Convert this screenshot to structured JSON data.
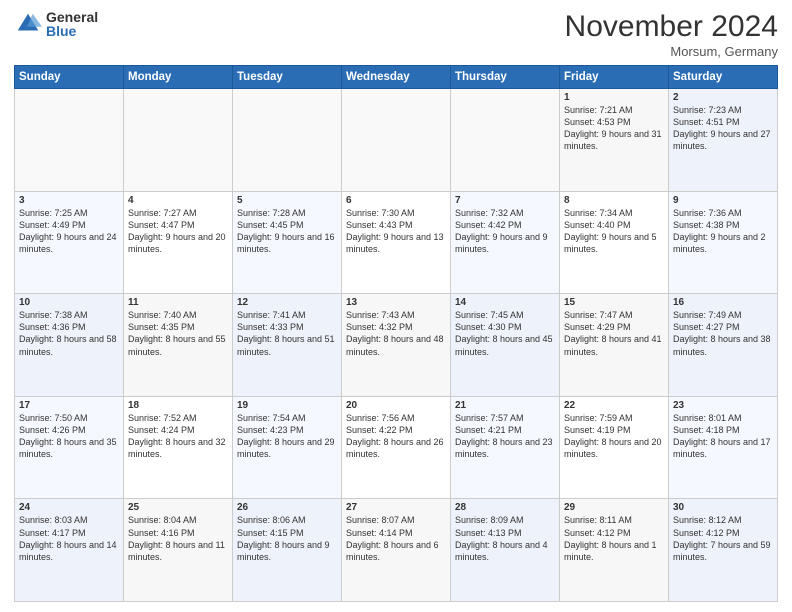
{
  "logo": {
    "general": "General",
    "blue": "Blue"
  },
  "header": {
    "month": "November 2024",
    "location": "Morsum, Germany"
  },
  "days_of_week": [
    "Sunday",
    "Monday",
    "Tuesday",
    "Wednesday",
    "Thursday",
    "Friday",
    "Saturday"
  ],
  "weeks": [
    [
      {
        "day": "",
        "info": ""
      },
      {
        "day": "",
        "info": ""
      },
      {
        "day": "",
        "info": ""
      },
      {
        "day": "",
        "info": ""
      },
      {
        "day": "",
        "info": ""
      },
      {
        "day": "1",
        "info": "Sunrise: 7:21 AM\nSunset: 4:53 PM\nDaylight: 9 hours and 31 minutes."
      },
      {
        "day": "2",
        "info": "Sunrise: 7:23 AM\nSunset: 4:51 PM\nDaylight: 9 hours and 27 minutes."
      }
    ],
    [
      {
        "day": "3",
        "info": "Sunrise: 7:25 AM\nSunset: 4:49 PM\nDaylight: 9 hours and 24 minutes."
      },
      {
        "day": "4",
        "info": "Sunrise: 7:27 AM\nSunset: 4:47 PM\nDaylight: 9 hours and 20 minutes."
      },
      {
        "day": "5",
        "info": "Sunrise: 7:28 AM\nSunset: 4:45 PM\nDaylight: 9 hours and 16 minutes."
      },
      {
        "day": "6",
        "info": "Sunrise: 7:30 AM\nSunset: 4:43 PM\nDaylight: 9 hours and 13 minutes."
      },
      {
        "day": "7",
        "info": "Sunrise: 7:32 AM\nSunset: 4:42 PM\nDaylight: 9 hours and 9 minutes."
      },
      {
        "day": "8",
        "info": "Sunrise: 7:34 AM\nSunset: 4:40 PM\nDaylight: 9 hours and 5 minutes."
      },
      {
        "day": "9",
        "info": "Sunrise: 7:36 AM\nSunset: 4:38 PM\nDaylight: 9 hours and 2 minutes."
      }
    ],
    [
      {
        "day": "10",
        "info": "Sunrise: 7:38 AM\nSunset: 4:36 PM\nDaylight: 8 hours and 58 minutes."
      },
      {
        "day": "11",
        "info": "Sunrise: 7:40 AM\nSunset: 4:35 PM\nDaylight: 8 hours and 55 minutes."
      },
      {
        "day": "12",
        "info": "Sunrise: 7:41 AM\nSunset: 4:33 PM\nDaylight: 8 hours and 51 minutes."
      },
      {
        "day": "13",
        "info": "Sunrise: 7:43 AM\nSunset: 4:32 PM\nDaylight: 8 hours and 48 minutes."
      },
      {
        "day": "14",
        "info": "Sunrise: 7:45 AM\nSunset: 4:30 PM\nDaylight: 8 hours and 45 minutes."
      },
      {
        "day": "15",
        "info": "Sunrise: 7:47 AM\nSunset: 4:29 PM\nDaylight: 8 hours and 41 minutes."
      },
      {
        "day": "16",
        "info": "Sunrise: 7:49 AM\nSunset: 4:27 PM\nDaylight: 8 hours and 38 minutes."
      }
    ],
    [
      {
        "day": "17",
        "info": "Sunrise: 7:50 AM\nSunset: 4:26 PM\nDaylight: 8 hours and 35 minutes."
      },
      {
        "day": "18",
        "info": "Sunrise: 7:52 AM\nSunset: 4:24 PM\nDaylight: 8 hours and 32 minutes."
      },
      {
        "day": "19",
        "info": "Sunrise: 7:54 AM\nSunset: 4:23 PM\nDaylight: 8 hours and 29 minutes."
      },
      {
        "day": "20",
        "info": "Sunrise: 7:56 AM\nSunset: 4:22 PM\nDaylight: 8 hours and 26 minutes."
      },
      {
        "day": "21",
        "info": "Sunrise: 7:57 AM\nSunset: 4:21 PM\nDaylight: 8 hours and 23 minutes."
      },
      {
        "day": "22",
        "info": "Sunrise: 7:59 AM\nSunset: 4:19 PM\nDaylight: 8 hours and 20 minutes."
      },
      {
        "day": "23",
        "info": "Sunrise: 8:01 AM\nSunset: 4:18 PM\nDaylight: 8 hours and 17 minutes."
      }
    ],
    [
      {
        "day": "24",
        "info": "Sunrise: 8:03 AM\nSunset: 4:17 PM\nDaylight: 8 hours and 14 minutes."
      },
      {
        "day": "25",
        "info": "Sunrise: 8:04 AM\nSunset: 4:16 PM\nDaylight: 8 hours and 11 minutes."
      },
      {
        "day": "26",
        "info": "Sunrise: 8:06 AM\nSunset: 4:15 PM\nDaylight: 8 hours and 9 minutes."
      },
      {
        "day": "27",
        "info": "Sunrise: 8:07 AM\nSunset: 4:14 PM\nDaylight: 8 hours and 6 minutes."
      },
      {
        "day": "28",
        "info": "Sunrise: 8:09 AM\nSunset: 4:13 PM\nDaylight: 8 hours and 4 minutes."
      },
      {
        "day": "29",
        "info": "Sunrise: 8:11 AM\nSunset: 4:12 PM\nDaylight: 8 hours and 1 minute."
      },
      {
        "day": "30",
        "info": "Sunrise: 8:12 AM\nSunset: 4:12 PM\nDaylight: 7 hours and 59 minutes."
      }
    ]
  ]
}
